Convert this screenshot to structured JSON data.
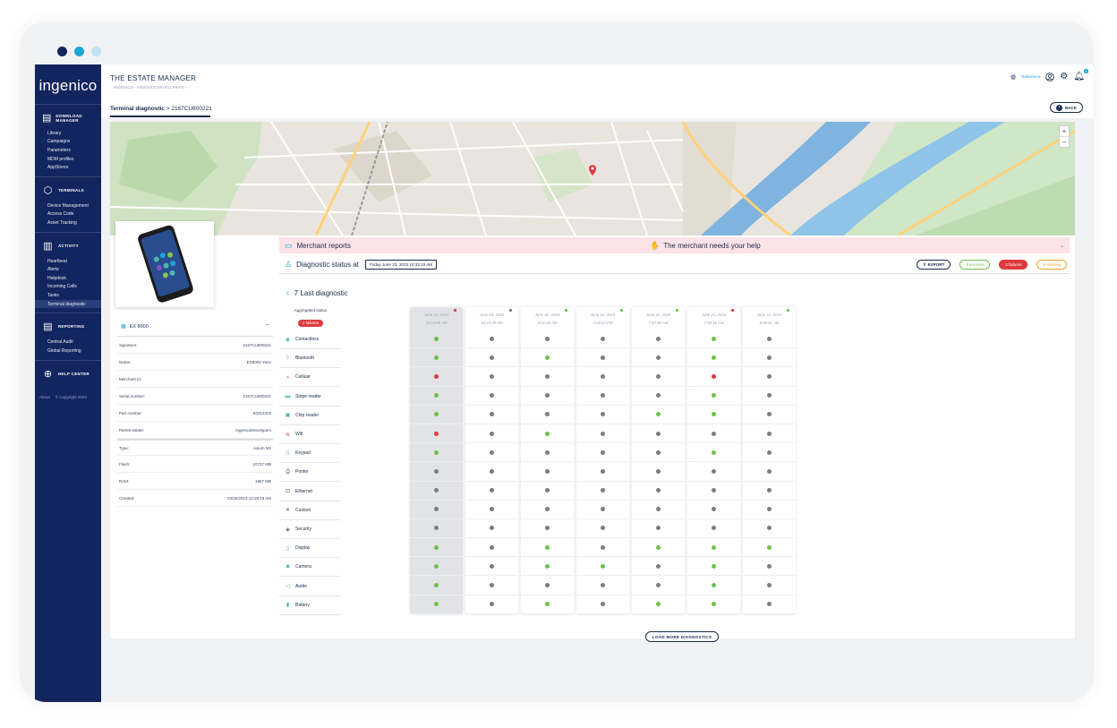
{
  "window_dots": [
    "#13255e",
    "#1fa5d6",
    "#bfe3f0"
  ],
  "sidebar": {
    "logo": "ingenico",
    "sections": [
      {
        "title": "DOWNLOAD MANAGER",
        "icon": "download-manager-icon",
        "items": [
          "Library",
          "Campaigns",
          "Parameters",
          "MDM profiles",
          "AppStores"
        ]
      },
      {
        "title": "TERMINALS",
        "icon": "terminal-cube-icon",
        "items": [
          "Device Management",
          "Access Code",
          "Asset Tracking"
        ]
      },
      {
        "title": "ACTIVITY",
        "icon": "activity-chart-icon",
        "items": [
          "Heartbeat",
          "Alerts",
          "Helpdesk",
          "Incoming Calls",
          "Tasks",
          "Terminal diagnostic"
        ]
      },
      {
        "title": "REPORTING",
        "icon": "report-icon",
        "items": [
          "Central Audit",
          "Global Reporting"
        ]
      },
      {
        "title": "HELP CENTER",
        "icon": "lifebuoy-icon",
        "items": []
      }
    ],
    "active_item": "Terminal diagnostic",
    "footer": {
      "about": "About",
      "copyright": "© Copyright 2023"
    }
  },
  "header": {
    "app_title": "THE ESTATE MANAGER",
    "breadcrumb": "INGENICO · INGENICODEVELOPERS ›",
    "user_label": "Salesforce",
    "notification_count": "3"
  },
  "page": {
    "title_bold": "Terminal diagnostic",
    "title_rest": " > 2167CU800221",
    "back_label": "BACK"
  },
  "device": {
    "model": "EX 8000",
    "fields": [
      {
        "label": "Signature:",
        "value": "2167CU800221"
      },
      {
        "label": "Name:",
        "value": "EX8000 Yann"
      },
      {
        "label": "Merchant Id:",
        "value": ""
      },
      {
        "label": "Serial number:",
        "value": "2167CU800221"
      },
      {
        "label": "Part number:",
        "value": "S0312203"
      },
      {
        "label": "Parent estate:",
        "value": "IngenicoDevelopers"
      },
      {
        "label": "Type:",
        "value": "Axium NX"
      },
      {
        "label": "Flash:",
        "value": "10737 MB"
      },
      {
        "label": "RAM:",
        "value": "1867 MB"
      },
      {
        "label": "Created:",
        "value": "03/30/2023 10:28:19 AM"
      }
    ]
  },
  "merchant": {
    "title": "Merchant reports",
    "alert": "The merchant needs your help"
  },
  "diagnostic": {
    "status_label": "Diagnostic status at",
    "status_date": "Friday June 23, 2023 10:33:19 AM",
    "export_label": "EXPORT",
    "success_label": "9 success",
    "failures_label": "2 failures",
    "warning_label": "0 warning",
    "last_title": "7 Last diagnostic",
    "aggregated_title": "Aggregated status",
    "aggregated_badge": "2 failures",
    "load_more": "LOAD MORE DIAGNOSTICS",
    "checks": [
      "Contactless",
      "Bluetooth",
      "Cellular",
      "Stripe reader",
      "Chip reader",
      "Wifi",
      "Keypad",
      "Printer",
      "Ethernet",
      "Custom",
      "Security",
      "Display",
      "Camera",
      "Audio",
      "Battery"
    ],
    "check_icons": [
      "contactless-icon",
      "bluetooth-icon",
      "cellular-icon",
      "stripe-reader-icon",
      "chip-reader-icon",
      "wifi-icon",
      "keypad-icon",
      "printer-icon",
      "ethernet-icon",
      "custom-icon",
      "security-icon",
      "display-icon",
      "camera-icon",
      "audio-icon",
      "battery-icon"
    ],
    "columns": [
      {
        "date": "June 23, 2023",
        "time": "10:10:09 AM",
        "flag": "red",
        "statuses": [
          "ok",
          "ok",
          "fail",
          "ok",
          "ok",
          "fail",
          "ok",
          "na",
          "na",
          "na",
          "na",
          "ok",
          "ok",
          "ok",
          "ok"
        ]
      },
      {
        "date": "June 23, 2023",
        "time": "10:24:30 AM",
        "flag": "grey",
        "statuses": [
          "na",
          "na",
          "na",
          "na",
          "na",
          "na",
          "na",
          "na",
          "na",
          "na",
          "na",
          "na",
          "na",
          "na",
          "na"
        ]
      },
      {
        "date": "June 22, 2023",
        "time": "8:12:20 AM",
        "flag": "green",
        "statuses": [
          "na",
          "ok",
          "na",
          "na",
          "na",
          "ok",
          "na",
          "na",
          "na",
          "na",
          "na",
          "ok",
          "ok",
          "na",
          "ok"
        ]
      },
      {
        "date": "June 22, 2023",
        "time": "2:56:42 PM",
        "flag": "green",
        "statuses": [
          "na",
          "na",
          "na",
          "na",
          "na",
          "na",
          "na",
          "na",
          "na",
          "na",
          "na",
          "na",
          "ok",
          "na",
          "na"
        ]
      },
      {
        "date": "June 22, 2023",
        "time": "7:47:30 AM",
        "flag": "green",
        "statuses": [
          "na",
          "na",
          "na",
          "na",
          "ok",
          "na",
          "na",
          "na",
          "na",
          "na",
          "na",
          "ok",
          "na",
          "na",
          "ok"
        ]
      },
      {
        "date": "June 21, 2023",
        "time": "7:50:16 AM",
        "flag": "red",
        "statuses": [
          "ok",
          "ok",
          "fail",
          "ok",
          "ok",
          "na",
          "ok",
          "na",
          "na",
          "na",
          "na",
          "ok",
          "ok",
          "ok",
          "ok"
        ]
      },
      {
        "date": "June 21, 2023",
        "time": "8:30:01 AM",
        "flag": "green",
        "statuses": [
          "na",
          "na",
          "na",
          "na",
          "na",
          "na",
          "na",
          "na",
          "na",
          "na",
          "na",
          "ok",
          "na",
          "na",
          "na"
        ]
      }
    ],
    "status_colors": {
      "ok": "#6cc24a",
      "fail": "#e03a3e",
      "na": "#7a7d85"
    }
  }
}
